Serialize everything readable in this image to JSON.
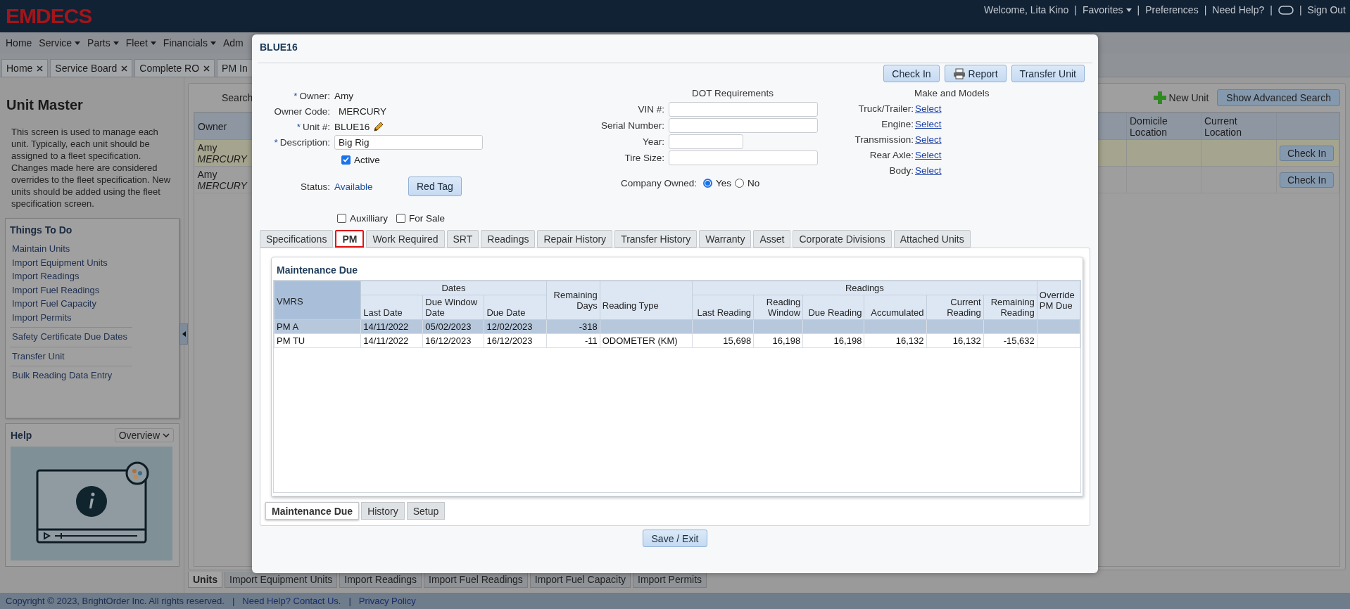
{
  "header": {
    "logo": "EMDECS",
    "items": [
      {
        "kind": "text",
        "label": "Welcome, Lita Kino"
      },
      {
        "kind": "separator",
        "label": "|"
      },
      {
        "kind": "dropdown",
        "label": "Favorites"
      },
      {
        "kind": "separator",
        "label": "|"
      },
      {
        "kind": "link",
        "label": "Preferences"
      },
      {
        "kind": "separator",
        "label": "|"
      },
      {
        "kind": "link",
        "label": "Need Help?"
      },
      {
        "kind": "separator",
        "label": "|"
      },
      {
        "kind": "toggle"
      },
      {
        "kind": "separator",
        "label": "|"
      },
      {
        "kind": "link",
        "label": "Sign Out"
      }
    ]
  },
  "menu": [
    {
      "label": "Home",
      "dropdown": false
    },
    {
      "label": "Service",
      "dropdown": true
    },
    {
      "label": "Parts",
      "dropdown": true
    },
    {
      "label": "Fleet",
      "dropdown": true
    },
    {
      "label": "Financials",
      "dropdown": true
    },
    {
      "label": "Adm",
      "dropdown": false
    }
  ],
  "open_tabs": [
    {
      "label": "Home",
      "closable": true
    },
    {
      "label": "Service Board",
      "closable": true
    },
    {
      "label": "Complete RO",
      "closable": true
    },
    {
      "label": "PM In",
      "closable": false
    }
  ],
  "sidebar": {
    "title": "Unit Master",
    "description": "This screen is used to manage each unit. Typically, each unit should be assigned to a fleet specification. Changes made here are considered overrides to the fleet specification. New units should be added using the fleet specification screen.",
    "things_to_do": {
      "title": "Things To Do",
      "groups": [
        [
          "Maintain Units",
          "Import Equipment Units",
          "Import Readings",
          "Import Fuel Readings",
          "Import Fuel Capacity",
          "Import Permits"
        ],
        [
          "Safety Certificate Due Dates"
        ],
        [
          "Transfer Unit"
        ],
        [
          "Bulk Reading Data Entry"
        ]
      ]
    },
    "help": {
      "title": "Help",
      "topic": "Overview"
    }
  },
  "unit_list": {
    "search_label": "Search",
    "new_unit": "New Unit",
    "advanced_search": "Show Advanced Search",
    "columns": [
      "Owner",
      "Domicile Location",
      "Current Location"
    ],
    "rows": [
      {
        "owner": "Amy",
        "owner_code": "MERCURY",
        "highlighted": true,
        "action": "Check In"
      },
      {
        "owner": "Amy",
        "owner_code": "MERCURY",
        "highlighted": false,
        "action": "Check In"
      }
    ],
    "tabs": [
      {
        "label": "Units",
        "selected": true
      },
      {
        "label": "Import Equipment Units",
        "selected": false
      },
      {
        "label": "Import Readings",
        "selected": false
      },
      {
        "label": "Import Fuel Readings",
        "selected": false
      },
      {
        "label": "Import Fuel Capacity",
        "selected": false
      },
      {
        "label": "Import Permits",
        "selected": false
      }
    ]
  },
  "footer": [
    {
      "kind": "text",
      "label": "Copyright © 2023, BrightOrder Inc. All rights reserved."
    },
    {
      "kind": "separator",
      "label": "|"
    },
    {
      "kind": "link",
      "label": "Need Help? Contact Us."
    },
    {
      "kind": "separator",
      "label": "|"
    },
    {
      "kind": "link",
      "label": "Privacy Policy"
    }
  ],
  "dialog": {
    "title": "BLUE16",
    "actions": [
      {
        "label": "Check In",
        "kind": "plain"
      },
      {
        "label": "Report",
        "kind": "print"
      },
      {
        "label": "Transfer Unit",
        "kind": "plain"
      }
    ],
    "unit_fields": [
      {
        "mark": "*",
        "label": "Owner:",
        "value": "Amy",
        "kind": "text"
      },
      {
        "label": "Owner Code:",
        "value": "MERCURY",
        "kind": "text"
      },
      {
        "mark": "*",
        "label": "Unit #:",
        "value": "BLUE16",
        "kind": "editable"
      },
      {
        "mark": "*",
        "label": "Description:",
        "value": "Big Rig",
        "kind": "input"
      }
    ],
    "active": {
      "label": "Active",
      "checked": true
    },
    "status": {
      "label": "Status:",
      "value": "Available",
      "button": "Red Tag"
    },
    "flags": [
      {
        "label": "Auxilliary",
        "checked": false
      },
      {
        "label": "For Sale",
        "checked": false
      }
    ],
    "dot": {
      "title": "DOT Requirements",
      "fields": [
        {
          "label": "VIN #:",
          "kind": "long"
        },
        {
          "label": "Serial Number:",
          "kind": "long"
        },
        {
          "label": "Year:",
          "kind": "short"
        },
        {
          "label": "Tire Size:",
          "kind": "long"
        }
      ],
      "company_owned": {
        "label": "Company Owned:",
        "options": [
          {
            "label": "Yes",
            "selected": true
          },
          {
            "label": "No",
            "selected": false
          }
        ]
      }
    },
    "make_models": {
      "title": "Make and Models",
      "rows": [
        {
          "label": "Truck/Trailer:",
          "link": "Select"
        },
        {
          "label": "Engine:",
          "link": "Select"
        },
        {
          "label": "Transmission:",
          "link": "Select"
        },
        {
          "label": "Rear Axle:",
          "link": "Select"
        },
        {
          "label": "Body:",
          "link": "Select"
        }
      ]
    },
    "tabs": [
      {
        "label": "Specifications",
        "selected": false
      },
      {
        "label": "PM",
        "selected": true
      },
      {
        "label": "Work Required",
        "selected": false
      },
      {
        "label": "SRT",
        "selected": false
      },
      {
        "label": "Readings",
        "selected": false
      },
      {
        "label": "Repair History",
        "selected": false
      },
      {
        "label": "Transfer History",
        "selected": false
      },
      {
        "label": "Warranty",
        "selected": false
      },
      {
        "label": "Asset",
        "selected": false
      },
      {
        "label": "Corporate Divisions",
        "selected": false
      },
      {
        "label": "Attached Units",
        "selected": false
      }
    ],
    "pm": {
      "title": "Maintenance Due",
      "headers": [
        {
          "kind": "single",
          "label": "VMRS"
        },
        {
          "kind": "group",
          "label": "Dates",
          "columns": [
            "Last Date",
            "Due Window Date",
            "Due Date"
          ]
        },
        {
          "kind": "single",
          "label": "Remaining Days"
        },
        {
          "kind": "single",
          "label": "Reading Type"
        },
        {
          "kind": "group",
          "label": "Readings",
          "columns": [
            "Last Reading",
            "Reading Window",
            "Due Reading",
            "Accumulated",
            "Current Reading",
            "Remaining Reading"
          ]
        },
        {
          "kind": "single",
          "label": "Override PM Due"
        }
      ],
      "rows": [
        {
          "selected": true,
          "cells": [
            "PM A",
            "14/11/2022",
            "05/02/2023",
            "12/02/2023",
            "-318"
          ]
        },
        {
          "selected": false,
          "cells": [
            "PM TU",
            "14/11/2022",
            "16/12/2023",
            "16/12/2023",
            "-11",
            "ODOMETER (KM)",
            "15,698",
            "16,198",
            "16,198",
            "16,132",
            "16,132",
            "-15,632"
          ]
        }
      ]
    },
    "sub_tabs": [
      {
        "label": "Maintenance Due",
        "selected": true
      },
      {
        "label": "History",
        "selected": false
      },
      {
        "label": "Setup",
        "selected": false
      }
    ],
    "save": "Save / Exit"
  }
}
